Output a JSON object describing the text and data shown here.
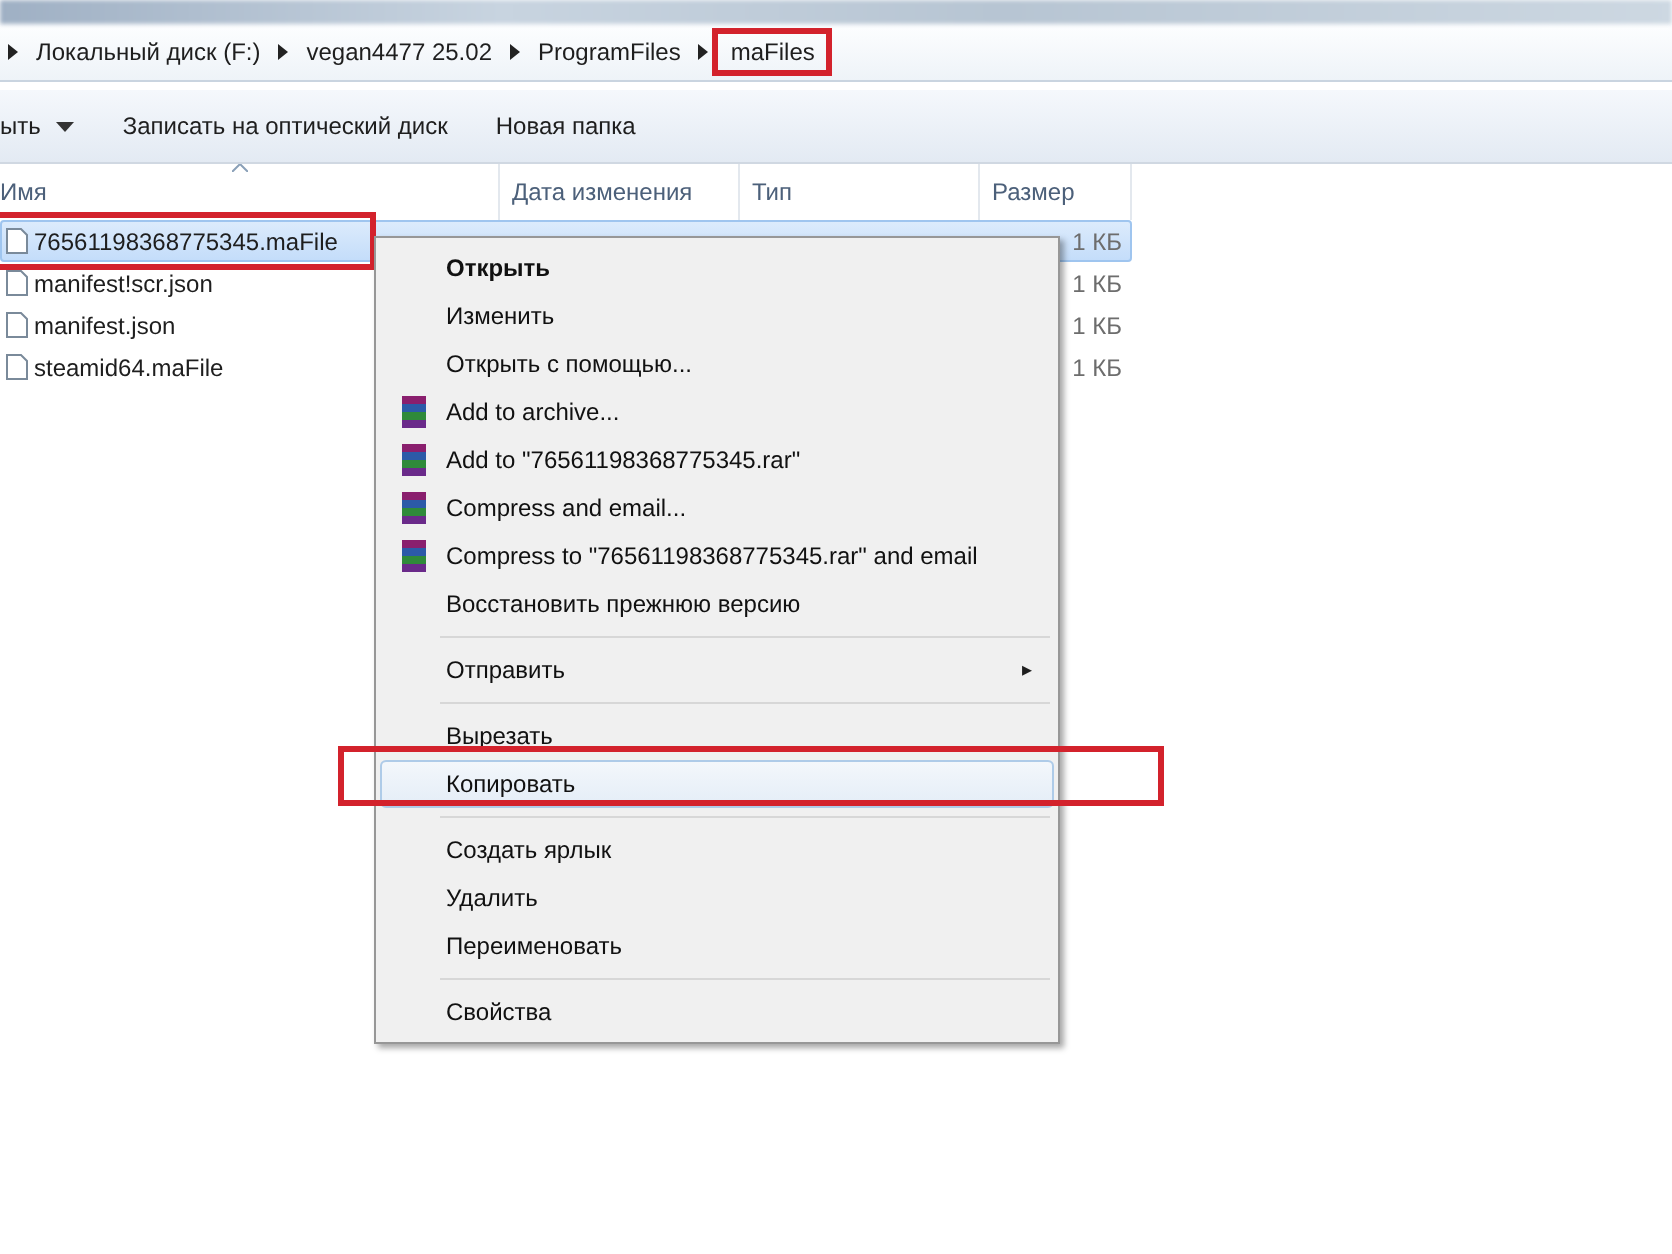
{
  "breadcrumb": [
    {
      "label": "Локальный диск (F:)",
      "highlighted": false
    },
    {
      "label": "vegan4477 25.02",
      "highlighted": false
    },
    {
      "label": "ProgramFiles",
      "highlighted": false
    },
    {
      "label": "maFiles",
      "highlighted": true
    }
  ],
  "toolbar": [
    {
      "label": "ыть",
      "dropdown": true
    },
    {
      "label": "Записать на оптический диск",
      "dropdown": false
    },
    {
      "label": "Новая папка",
      "dropdown": false
    }
  ],
  "columns": [
    "Имя",
    "Дата изменения",
    "Тип",
    "Размер"
  ],
  "files": [
    {
      "name": "76561198368775345.maFile",
      "size": "1 КБ",
      "selected": true,
      "highlighted": true
    },
    {
      "name": "manifest!scr.json",
      "size": "1 КБ",
      "selected": false,
      "highlighted": false
    },
    {
      "name": "manifest.json",
      "size": "1 КБ",
      "selected": false,
      "highlighted": false
    },
    {
      "name": "steamid64.maFile",
      "size": "1 КБ",
      "selected": false,
      "highlighted": false
    }
  ],
  "context_menu": [
    {
      "kind": "item",
      "label": "Открыть",
      "bold": true
    },
    {
      "kind": "item",
      "label": "Изменить"
    },
    {
      "kind": "item",
      "label": "Открыть с помощью..."
    },
    {
      "kind": "rar",
      "label": "Add to archive..."
    },
    {
      "kind": "rar",
      "label": "Add to \"76561198368775345.rar\""
    },
    {
      "kind": "rar",
      "label": "Compress and email..."
    },
    {
      "kind": "rar",
      "label": "Compress to \"76561198368775345.rar\" and email"
    },
    {
      "kind": "item",
      "label": "Восстановить прежнюю версию"
    },
    {
      "kind": "separator"
    },
    {
      "kind": "submenu",
      "label": "Отправить",
      "arrow": "▸"
    },
    {
      "kind": "separator"
    },
    {
      "kind": "item",
      "label": "Вырезать"
    },
    {
      "kind": "item",
      "label": "Копировать",
      "selected": true,
      "highlighted": true
    },
    {
      "kind": "separator"
    },
    {
      "kind": "item",
      "label": "Создать ярлык"
    },
    {
      "kind": "item",
      "label": "Удалить"
    },
    {
      "kind": "item",
      "label": "Переименовать"
    },
    {
      "kind": "separator"
    },
    {
      "kind": "item",
      "label": "Свойства"
    }
  ]
}
